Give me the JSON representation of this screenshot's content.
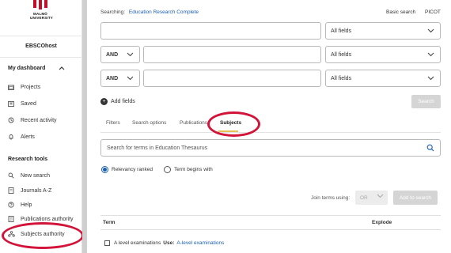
{
  "logo": {
    "line1": "MALMÖ",
    "line2": "UNIVERSITY",
    "brand_color": "#c0102a"
  },
  "sidebar": {
    "ebsco_label": "EBSCOhost",
    "dashboard_title": "My dashboard",
    "dashboard_items": [
      {
        "label": "Projects",
        "icon": "folder-icon"
      },
      {
        "label": "Saved",
        "icon": "bookmark-icon"
      },
      {
        "label": "Recent activity",
        "icon": "history-icon"
      },
      {
        "label": "Alerts",
        "icon": "bell-icon"
      }
    ],
    "research_tools_title": "Research tools",
    "research_items": [
      {
        "label": "New search",
        "icon": "search-icon"
      },
      {
        "label": "Journals A-Z",
        "icon": "journal-icon"
      },
      {
        "label": "Help",
        "icon": "help-icon"
      },
      {
        "label": "Publications authority",
        "icon": "publications-icon"
      },
      {
        "label": "Subjects authority",
        "icon": "subjects-icon"
      }
    ]
  },
  "header": {
    "searching_label": "Searching:",
    "database": "Education Research Complete",
    "basic_search": "Basic search",
    "picot": "PICOT"
  },
  "search_rows": [
    {
      "operator": "",
      "value": "",
      "field": "All fields"
    },
    {
      "operator": "AND",
      "value": "",
      "field": "All fields"
    },
    {
      "operator": "AND",
      "value": "",
      "field": "All fields"
    }
  ],
  "add_fields_label": "Add fields",
  "search_button": "Search",
  "tabs": [
    "Filters",
    "Search options",
    "Publications",
    "Subjects"
  ],
  "active_tab": "Subjects",
  "thesaurus": {
    "placeholder": "Search for terms in Education Thesaurus"
  },
  "ranking": {
    "option1": "Relevancy ranked",
    "option2": "Term begins with",
    "selected": "Relevancy ranked"
  },
  "join": {
    "label": "Join terms using:",
    "value": "OR",
    "add_button": "Add to search"
  },
  "table": {
    "headers": [
      "Term",
      "Explode"
    ],
    "rows": [
      {
        "term": "A level examinations",
        "use_label": "Use:",
        "link": "A-level examinations"
      }
    ]
  },
  "accent_color": "#1b5fb3",
  "highlight_color": "#d2143a"
}
